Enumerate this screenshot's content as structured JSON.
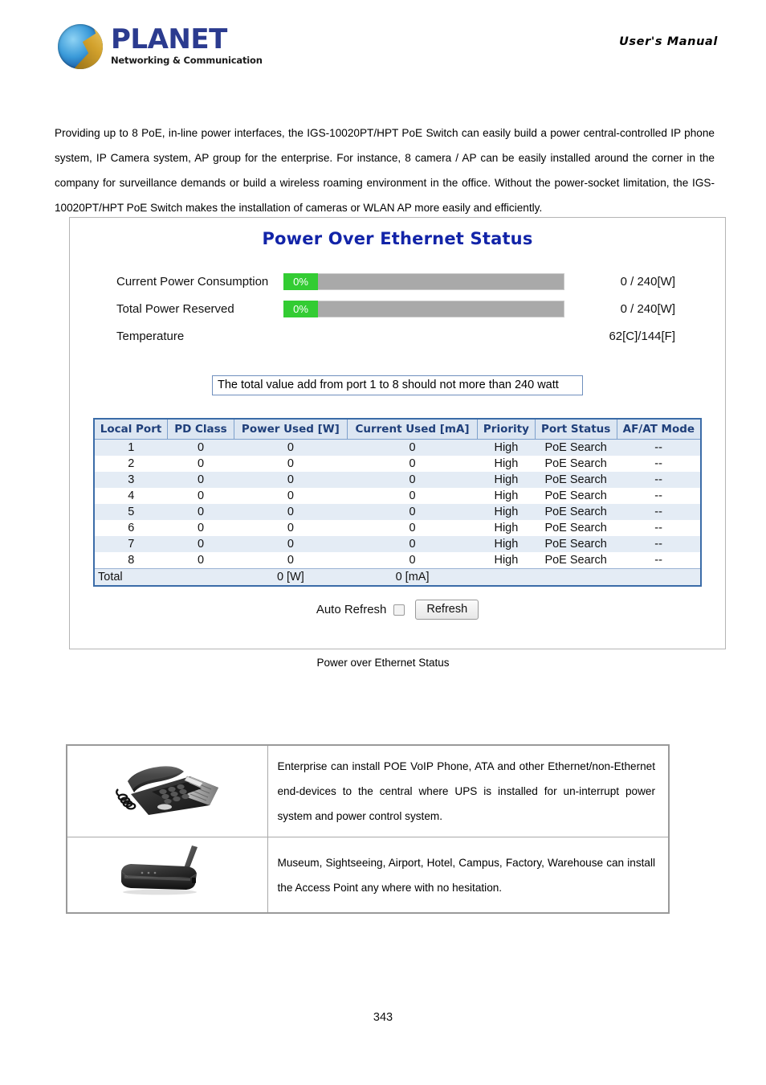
{
  "header": {
    "brand_wordmark": "PLANET",
    "brand_tagline": "Networking & Communication",
    "manual_label": "User's  Manual",
    "logo_icon": "planet-globe-logo"
  },
  "intro": {
    "paragraph": "Providing up to 8 PoE, in-line power interfaces, the IGS-10020PT/HPT PoE Switch can easily build a power central-controlled IP phone system, IP Camera system, AP group for the enterprise. For instance, 8 camera / AP can be easily installed around the corner in the company for surveillance demands or build a wireless roaming environment in the office. Without the power-socket limitation, the IGS-10020PT/HPT PoE Switch makes the installation of cameras or WLAN AP more easily and efficiently."
  },
  "screenshot": {
    "title": "Power Over Ethernet Status",
    "meters": [
      {
        "label": "Current Power Consumption",
        "percent_text": "0%",
        "percent_value": 0,
        "value_text": "0 / 240[W]",
        "fill_color": "#33cc33",
        "track_color": "#a9a9a9"
      },
      {
        "label": "Total Power Reserved",
        "percent_text": "0%",
        "percent_value": 0,
        "value_text": "0 / 240[W]",
        "fill_color": "#33cc33",
        "track_color": "#a9a9a9"
      }
    ],
    "temperature": {
      "label": "Temperature",
      "value_text": "62[C]/144[F]"
    },
    "notice": "The total value add from port 1 to 8 should not more than 240 watt",
    "table": {
      "columns": [
        "Local Port",
        "PD Class",
        "Power Used [W]",
        "Current Used [mA]",
        "Priority",
        "Port Status",
        "AF/AT Mode"
      ],
      "rows": [
        [
          "1",
          "0",
          "0",
          "0",
          "High",
          "PoE Search",
          "--"
        ],
        [
          "2",
          "0",
          "0",
          "0",
          "High",
          "PoE Search",
          "--"
        ],
        [
          "3",
          "0",
          "0",
          "0",
          "High",
          "PoE Search",
          "--"
        ],
        [
          "4",
          "0",
          "0",
          "0",
          "High",
          "PoE Search",
          "--"
        ],
        [
          "5",
          "0",
          "0",
          "0",
          "High",
          "PoE Search",
          "--"
        ],
        [
          "6",
          "0",
          "0",
          "0",
          "High",
          "PoE Search",
          "--"
        ],
        [
          "7",
          "0",
          "0",
          "0",
          "High",
          "PoE Search",
          "--"
        ],
        [
          "8",
          "0",
          "0",
          "0",
          "High",
          "PoE Search",
          "--"
        ]
      ],
      "total_row": {
        "label": "Total",
        "pd_class": "",
        "power_used": "0 [W]",
        "current_used": "0 [mA]",
        "priority": "",
        "port_status": "",
        "af_at_mode": ""
      },
      "header_bg": "#dce6f2",
      "header_text_color": "#1f3f7a",
      "stripe_color": "#e4ecf5",
      "border_color": "#3b6ca8"
    },
    "controls": {
      "auto_refresh_label": "Auto Refresh",
      "auto_refresh_checked": false,
      "refresh_button": "Refresh"
    }
  },
  "figure_caption": "Power over Ethernet Status",
  "applications": {
    "rows": [
      {
        "image_name": "voip-desk-phone-image",
        "text": "Enterprise can install POE VoIP Phone, ATA and other Ethernet/non-Ethernet end-devices to the central where UPS is installed for un-interrupt power system and power control system."
      },
      {
        "image_name": "wireless-access-point-image",
        "text": "Museum, Sightseeing, Airport, Hotel, Campus, Factory, Warehouse can install the Access Point any where with no hesitation."
      }
    ]
  },
  "footer": {
    "page_number": "343"
  }
}
